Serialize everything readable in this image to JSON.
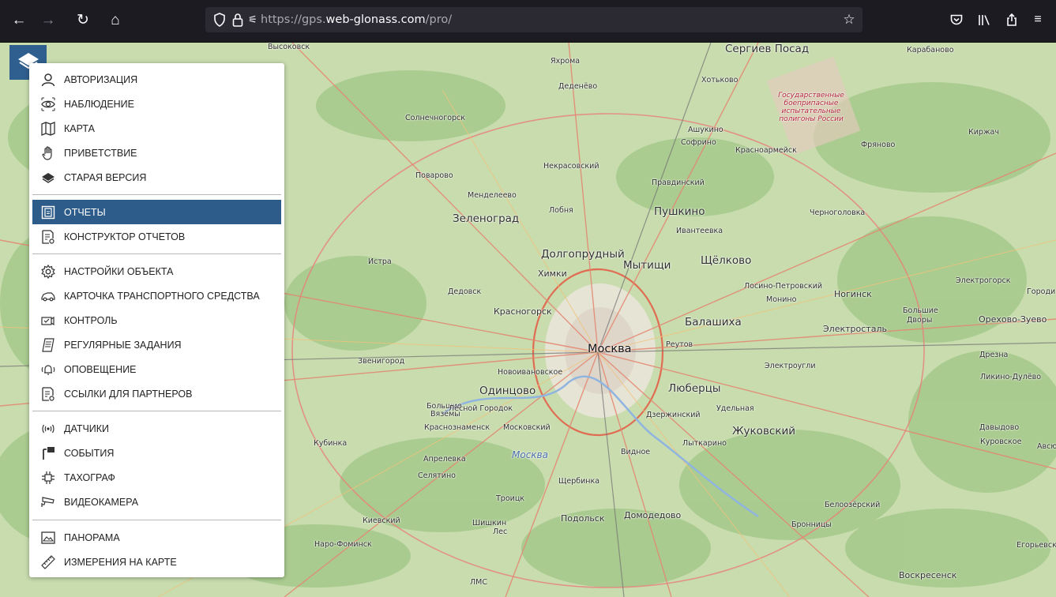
{
  "browser": {
    "url_scheme": "https://gps.",
    "url_host": "web-glonass.com",
    "url_path": "/pro/"
  },
  "menu": {
    "items": [
      {
        "label": "АВТОРИЗАЦИЯ",
        "icon": "user-icon"
      },
      {
        "label": "НАБЛЮДЕНИЕ",
        "icon": "eye-icon"
      },
      {
        "label": "КАРТА",
        "icon": "map-icon"
      },
      {
        "label": "ПРИВЕТСТВИЕ",
        "icon": "hand-icon"
      },
      {
        "label": "СТАРАЯ ВЕРСИЯ",
        "icon": "layers-icon"
      },
      {
        "label": "ОТЧЕТЫ",
        "icon": "report-icon",
        "active": true
      },
      {
        "label": "КОНСТРУКТОР ОТЧЕТОВ",
        "icon": "report-builder-icon"
      },
      {
        "label": "НАСТРОЙКИ ОБЪЕКТА",
        "icon": "gear-icon"
      },
      {
        "label": "КАРТОЧКА ТРАНСПОРТНОГО СРЕДСТВА",
        "icon": "car-icon"
      },
      {
        "label": "КОНТРОЛЬ",
        "icon": "control-icon"
      },
      {
        "label": "РЕГУЛЯРНЫЕ ЗАДАНИЯ",
        "icon": "tasks-icon"
      },
      {
        "label": "ОПОВЕЩЕНИЕ",
        "icon": "bell-icon"
      },
      {
        "label": "ССЫЛКИ ДЛЯ ПАРТНЕРОВ",
        "icon": "links-icon"
      },
      {
        "label": "ДАТЧИКИ",
        "icon": "sensor-icon"
      },
      {
        "label": "СОБЫТИЯ",
        "icon": "events-icon"
      },
      {
        "label": "ТАХОГРАФ",
        "icon": "tachograph-icon"
      },
      {
        "label": "ВИДЕОКАМЕРА",
        "icon": "camera-icon"
      },
      {
        "label": "ПАНОРАМА",
        "icon": "panorama-icon"
      },
      {
        "label": "ИЗМЕРЕНИЯ НА КАРТЕ",
        "icon": "ruler-icon"
      }
    ]
  },
  "map": {
    "places": [
      {
        "name": "Высоковск"
      },
      {
        "name": "Сергиев Посад"
      },
      {
        "name": "Карабаново"
      },
      {
        "name": "Яхрома"
      },
      {
        "name": "Хотьково"
      },
      {
        "name": "Деденёво"
      },
      {
        "name": "Солнечногорск"
      },
      {
        "name": "Ашукино"
      },
      {
        "name": "Софрино"
      },
      {
        "name": "Красноармейск"
      },
      {
        "name": "Фряново"
      },
      {
        "name": "Киржач"
      },
      {
        "name": "Некрасовский"
      },
      {
        "name": "Поварово"
      },
      {
        "name": "Правдинский"
      },
      {
        "name": "Менделеево"
      },
      {
        "name": "Зеленоград"
      },
      {
        "name": "Лобня"
      },
      {
        "name": "Пушкино"
      },
      {
        "name": "Черноголовка"
      },
      {
        "name": "Ивантеевка"
      },
      {
        "name": "Истра"
      },
      {
        "name": "Долгопрудный"
      },
      {
        "name": "Мытищи"
      },
      {
        "name": "Щёлково"
      },
      {
        "name": "Химки"
      },
      {
        "name": "Дедовск"
      },
      {
        "name": "Лосино-Петровский"
      },
      {
        "name": "Монино"
      },
      {
        "name": "Ногинск"
      },
      {
        "name": "Электрогорск"
      },
      {
        "name": "Городи"
      },
      {
        "name": "Красногорск"
      },
      {
        "name": "Балашиха"
      },
      {
        "name": "Электросталь"
      },
      {
        "name": "Большие"
      },
      {
        "name": "Дворы"
      },
      {
        "name": "Орехово-Зуево"
      },
      {
        "name": "Реутов"
      },
      {
        "name": "Москва"
      },
      {
        "name": "Звенигород"
      },
      {
        "name": "Дрезна"
      },
      {
        "name": "Новоивановское"
      },
      {
        "name": "Электроугли"
      },
      {
        "name": "Ликино-Дулёво"
      },
      {
        "name": "Одинцово"
      },
      {
        "name": "Люберцы"
      },
      {
        "name": "Большие"
      },
      {
        "name": "Вязёмы"
      },
      {
        "name": "Лесной Городок"
      },
      {
        "name": "Дзержинский"
      },
      {
        "name": "Удельная"
      },
      {
        "name": "Краснознаменск"
      },
      {
        "name": "Московский"
      },
      {
        "name": "Жуковский"
      },
      {
        "name": "Давыдово"
      },
      {
        "name": "Куровское"
      },
      {
        "name": "Кубинка"
      },
      {
        "name": "Лыткарино"
      },
      {
        "name": "Апрелевка"
      },
      {
        "name": "Москва"
      },
      {
        "name": "Видное"
      },
      {
        "name": "Авсю"
      },
      {
        "name": "Селятино"
      },
      {
        "name": "Щербинка"
      },
      {
        "name": "Троицк"
      },
      {
        "name": "Белоозёрский"
      },
      {
        "name": "Киевский"
      },
      {
        "name": "Шишкин"
      },
      {
        "name": "Лес"
      },
      {
        "name": "Подольск"
      },
      {
        "name": "Домодедово"
      },
      {
        "name": "Бронницы"
      },
      {
        "name": "Наро-Фоминск"
      },
      {
        "name": "Егорьевск"
      },
      {
        "name": "ЛМС"
      },
      {
        "name": "Воскресенск"
      },
      {
        "name": "Государственные боеприпасные испытательные полигоны России"
      }
    ]
  }
}
